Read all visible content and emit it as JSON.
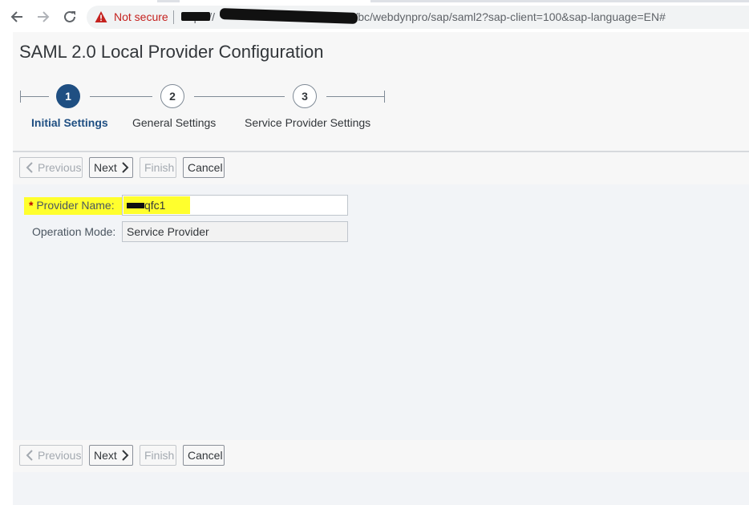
{
  "browser": {
    "security_label": "Not secure",
    "url_text": "https://                              8161/sap/bc/webdynpro/sap/saml2?sap-client=100&sap-language=EN#",
    "icons": [
      "back-arrow-icon",
      "forward-arrow-icon",
      "reload-icon",
      "warning-triangle-icon"
    ]
  },
  "page": {
    "title": "SAML 2.0 Local Provider Configuration"
  },
  "wizard": {
    "steps": [
      {
        "number": "1",
        "label": "Initial Settings",
        "state": "active"
      },
      {
        "number": "2",
        "label": "General Settings",
        "state": "inactive"
      },
      {
        "number": "3",
        "label": "Service Provider Settings",
        "state": "inactive"
      }
    ]
  },
  "toolbar": {
    "previous_label": "Previous",
    "next_label": "Next",
    "finish_label": "Finish",
    "cancel_label": "Cancel"
  },
  "form": {
    "required_marker": "*",
    "provider_name_label": "Provider Name:",
    "provider_name_value": "qfc1",
    "operation_mode_label": "Operation Mode:",
    "operation_mode_value": "Service Provider"
  },
  "colors": {
    "accent": "#1f4f82",
    "highlight": "#ffff2d",
    "warning": "#c5221f"
  }
}
